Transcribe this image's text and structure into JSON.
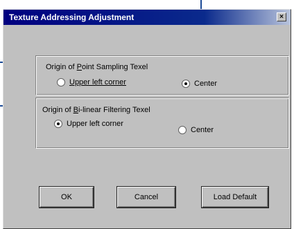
{
  "window": {
    "title": "Texture Addressing Adjustment",
    "close_glyph": "×"
  },
  "point_group": {
    "label_before": "Origin of ",
    "label_hotkey": "P",
    "label_after": "oint Sampling Texel",
    "options": [
      {
        "label": "Upper left corner",
        "checked": false
      },
      {
        "label": "Center",
        "checked": true
      }
    ]
  },
  "bilinear_group": {
    "label_before": "Origin of ",
    "label_hotkey": "B",
    "label_after": "i-linear Filtering Texel",
    "options": [
      {
        "label": "Upper left corner",
        "checked": true
      },
      {
        "label": "Center",
        "checked": false
      }
    ]
  },
  "buttons": {
    "ok": "OK",
    "cancel": "Cancel",
    "load_default": "Load Default"
  },
  "colors": {
    "callout_line": "#1b4a96",
    "title_bar": "#000080",
    "dialog_face": "#c0c0c0"
  }
}
